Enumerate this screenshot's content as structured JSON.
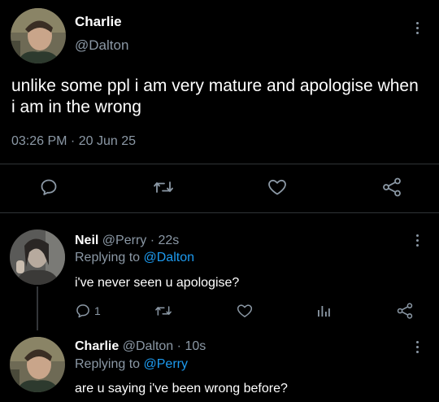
{
  "main_tweet": {
    "author_name": "Charlie",
    "author_handle": "@Dalton",
    "text": "unlike some ppl i am very mature and apologise when i am in the wrong",
    "timestamp": "03:26 PM · 20 Jun 25",
    "actions": {
      "reply_icon": "reply-icon",
      "retweet_icon": "retweet-icon",
      "like_icon": "heart-icon",
      "share_icon": "share-icon"
    }
  },
  "replies": [
    {
      "author_name": "Neil",
      "author_handle": "@Perry",
      "time_ago": "22s",
      "separator": "·",
      "replying_prefix": "Replying to",
      "replying_to": "@Dalton",
      "text": "i've never seen u apologise?",
      "reply_count": "1"
    },
    {
      "author_name": "Charlie",
      "author_handle": "@Dalton",
      "time_ago": "10s",
      "separator": "·",
      "replying_prefix": "Replying to",
      "replying_to": "@Perry",
      "text": "are u saying i've been wrong before?"
    }
  ],
  "colors": {
    "background": "#000000",
    "text": "#ffffff",
    "secondary": "#8b98a5",
    "accent": "#1d9bf0",
    "divider": "#2f3336"
  }
}
